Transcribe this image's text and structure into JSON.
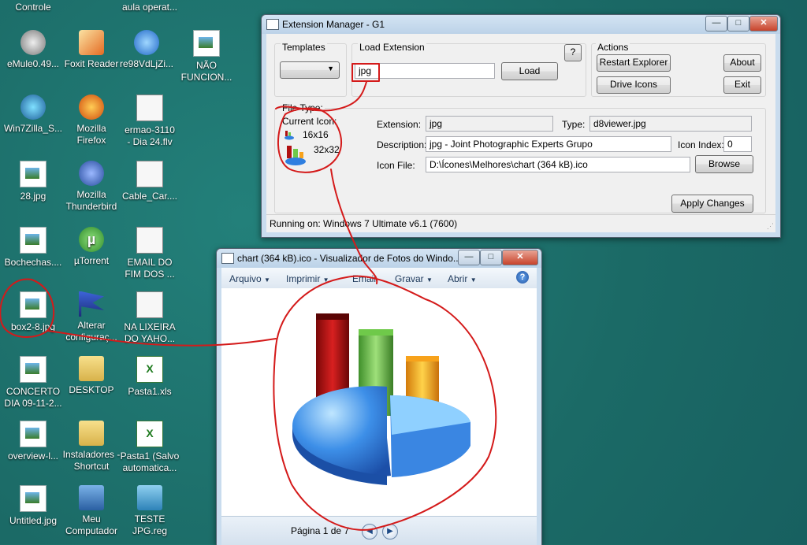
{
  "desktop": {
    "top_labels": {
      "left": "Controle",
      "mid": "aula operat..."
    },
    "icons": [
      {
        "label": "eMule0.49...",
        "sub": ""
      },
      {
        "label": "Foxit Reader",
        "sub": ""
      },
      {
        "label": "re98VdLjZi...",
        "sub": ""
      },
      {
        "label": "NÃO",
        "sub": "FUNCION..."
      },
      {
        "label": "Win7Zilla_S...",
        "sub": ""
      },
      {
        "label": "Mozilla",
        "sub": "Firefox"
      },
      {
        "label": "ermao-3110",
        "sub": "- Dia 24.flv"
      },
      {
        "label": "28.jpg",
        "sub": ""
      },
      {
        "label": "Mozilla",
        "sub": "Thunderbird"
      },
      {
        "label": "Cable_Car....",
        "sub": ""
      },
      {
        "label": "Bochechas....",
        "sub": ""
      },
      {
        "label": "µTorrent",
        "sub": ""
      },
      {
        "label": "EMAIL DO",
        "sub": "FIM DOS ..."
      },
      {
        "label": "box2-8.jpg",
        "sub": ""
      },
      {
        "label": "Alterar",
        "sub": "configuraç..."
      },
      {
        "label": "NA LIXEIRA",
        "sub": "DO YAHO..."
      },
      {
        "label": "CONCERTO",
        "sub": "DIA 09-11-2..."
      },
      {
        "label": "DESKTOP",
        "sub": ""
      },
      {
        "label": "Pasta1.xls",
        "sub": ""
      },
      {
        "label": "overview-l...",
        "sub": ""
      },
      {
        "label": "Instaladores -",
        "sub": "Shortcut"
      },
      {
        "label": "Pasta1 (Salvo",
        "sub": "automatica..."
      },
      {
        "label": "Untitled.jpg",
        "sub": ""
      },
      {
        "label": "Meu",
        "sub": "Computador"
      },
      {
        "label": "TESTE",
        "sub": "JPG.reg"
      }
    ]
  },
  "ext_manager": {
    "title": "Extension Manager - G1",
    "templates_label": "Templates",
    "load_ext_label": "Load Extension",
    "load_value": "jpg",
    "load_button": "Load",
    "help_button": "?",
    "actions_label": "Actions",
    "restart_button": "Restart Explorer",
    "about_button": "About",
    "drive_icons_button": "Drive Icons",
    "exit_button": "Exit",
    "file_type_label": "File Type:",
    "current_icon_label": "Current Icon:",
    "size_small": "16x16",
    "size_large": "32x32",
    "extension_label": "Extension:",
    "extension_value": "jpg",
    "type_label": "Type:",
    "type_value": "d8viewer.jpg",
    "description_label": "Description:",
    "description_value": "jpg - Joint Photographic Experts Grupo",
    "icon_index_label": "Icon Index:",
    "icon_index_value": "0",
    "icon_file_label": "Icon File:",
    "icon_file_value": "D:\\Ícones\\Melhores\\chart (364 kB).ico",
    "browse_button": "Browse",
    "apply_button": "Apply Changes",
    "status": "Running on: Windows 7 Ultimate v6.1 (7600)"
  },
  "photo_viewer": {
    "title": "chart (364 kB).ico - Visualizador de Fotos do Windo...",
    "menu": [
      "Arquivo",
      "Imprimir",
      "Email",
      "Gravar",
      "Abrir"
    ],
    "page_text": "Página 1 de 7",
    "colors": {
      "bar_red": "#b01010",
      "bar_green": "#6fc94a",
      "bar_orange": "#f7a21b",
      "pie_blue": "#2f7fe0",
      "annotation": "#d41a1a"
    }
  }
}
